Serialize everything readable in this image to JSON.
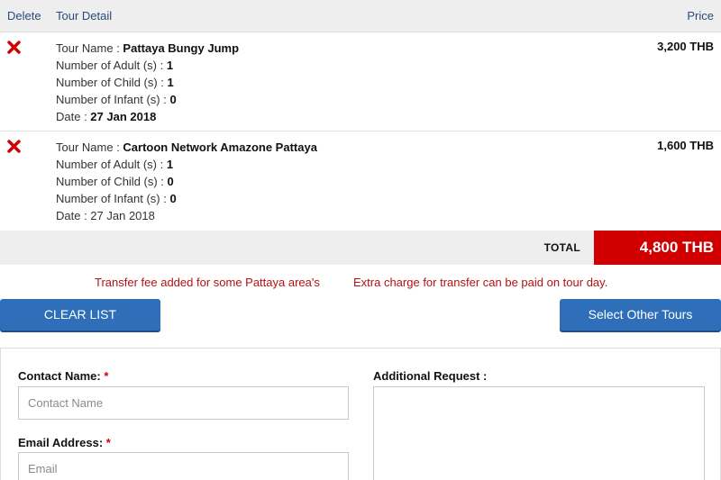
{
  "table": {
    "headers": {
      "delete": "Delete",
      "detail": "Tour Detail",
      "price": "Price"
    },
    "rows": [
      {
        "tour_label": "Tour Name : ",
        "tour_name": "Pattaya Bungy Jump",
        "adult_label": "Number of Adult (s) : ",
        "adult": "1",
        "child_label": "Number of Child (s) : ",
        "child": "1",
        "infant_label": "Number of Infant (s) : ",
        "infant": "0",
        "date_label": "Date : ",
        "date": "27 Jan 2018",
        "price": "3,200 THB"
      },
      {
        "tour_label": "Tour Name : ",
        "tour_name": "Cartoon Network Amazone Pattaya",
        "adult_label": "Number of Adult (s) : ",
        "adult": "1",
        "child_label": "Number of Child (s) : ",
        "child": "0",
        "infant_label": "Number of Infant (s) : ",
        "infant": "0",
        "date_label": "Date : ",
        "date": "27 Jan 2018",
        "price": "1,600 THB"
      }
    ],
    "total_label": "TOTAL",
    "total_value": "4,800 THB"
  },
  "notes": {
    "transfer_fee": "Transfer fee added for some Pattaya area's",
    "extra_charge": "Extra charge for transfer can be paid on tour day."
  },
  "buttons": {
    "clear": "CLEAR LIST",
    "select_other": "Select Other Tours"
  },
  "form": {
    "contact_label": "Contact Name:",
    "contact_placeholder": "Contact Name",
    "email_label": "Email Address:",
    "email_placeholder": "Email",
    "required_mark": "*",
    "request_label": "Additional Request :"
  },
  "colors": {
    "accent_blue": "#2f6fb9",
    "total_red": "#d10000",
    "note_red": "#b51010",
    "delete_red": "#d10000"
  },
  "icons": {
    "delete": "close-x-icon"
  }
}
